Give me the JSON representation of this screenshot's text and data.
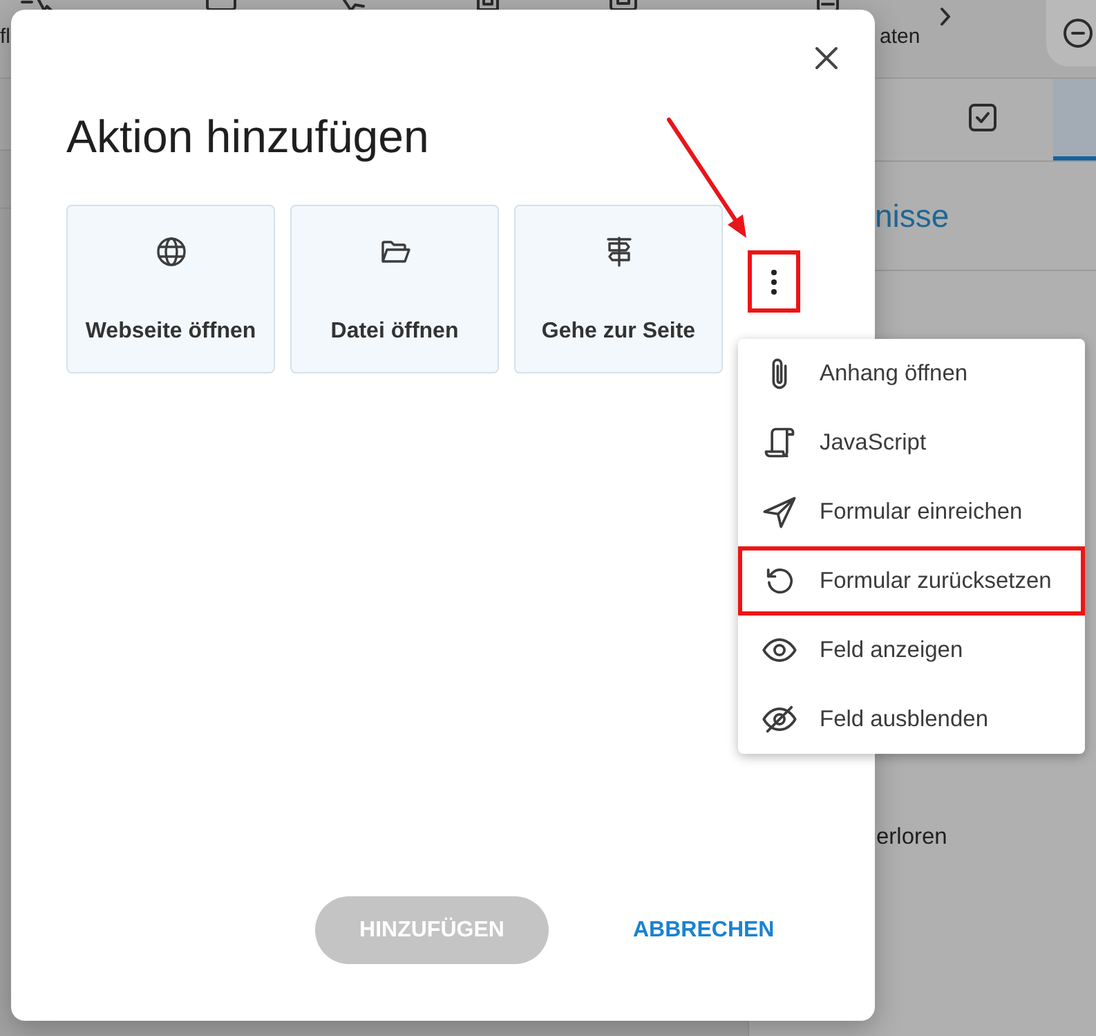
{
  "background": {
    "toolbar": {
      "labels": [
        "fl",
        "aten"
      ]
    },
    "panel": {
      "tabs": [
        {
          "selected": false
        },
        {
          "selected": true
        }
      ],
      "heading": "nisse",
      "text": "erloren"
    }
  },
  "dialog": {
    "title": "Aktion hinzufügen",
    "actions": [
      {
        "label": "Webseite öffnen"
      },
      {
        "label": "Datei öffnen"
      },
      {
        "label": "Gehe zur Seite"
      }
    ],
    "more_button": {
      "annotated": true
    },
    "buttons": [
      {
        "label": "HINZUFÜGEN",
        "kind": "primary",
        "disabled": true
      },
      {
        "label": "ABBRECHEN",
        "kind": "text",
        "disabled": false
      }
    ]
  },
  "menu": {
    "items": [
      {
        "label": "Anhang öffnen",
        "annotated": false
      },
      {
        "label": "JavaScript",
        "annotated": false
      },
      {
        "label": "Formular einreichen",
        "annotated": false
      },
      {
        "label": "Formular zurücksetzen",
        "annotated": true
      },
      {
        "label": "Feld anzeigen",
        "annotated": false
      },
      {
        "label": "Feld ausblenden",
        "annotated": false
      }
    ]
  }
}
